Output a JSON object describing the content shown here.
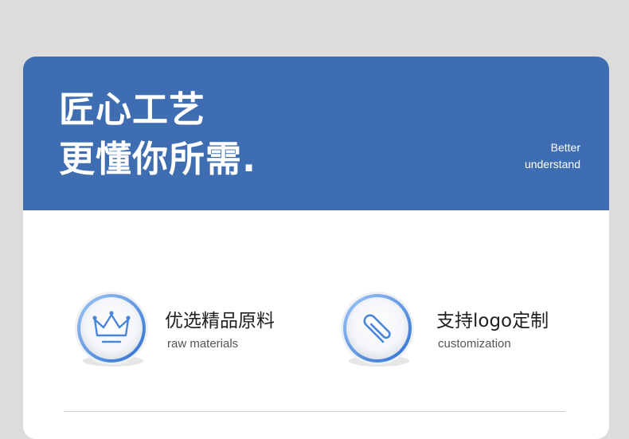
{
  "banner": {
    "headline_line1": "匠心工艺",
    "headline_line2": "更懂你所需.",
    "side_line1": "Better",
    "side_line2": "understand",
    "color": "#3e6db1"
  },
  "features": [
    {
      "title": "优选精品原料",
      "subtitle": "raw materials",
      "icon": "crown-icon"
    },
    {
      "title": "支持logo定制",
      "subtitle": "customization",
      "icon": "paperclip-icon"
    }
  ],
  "accent_color": "#4a86d9"
}
